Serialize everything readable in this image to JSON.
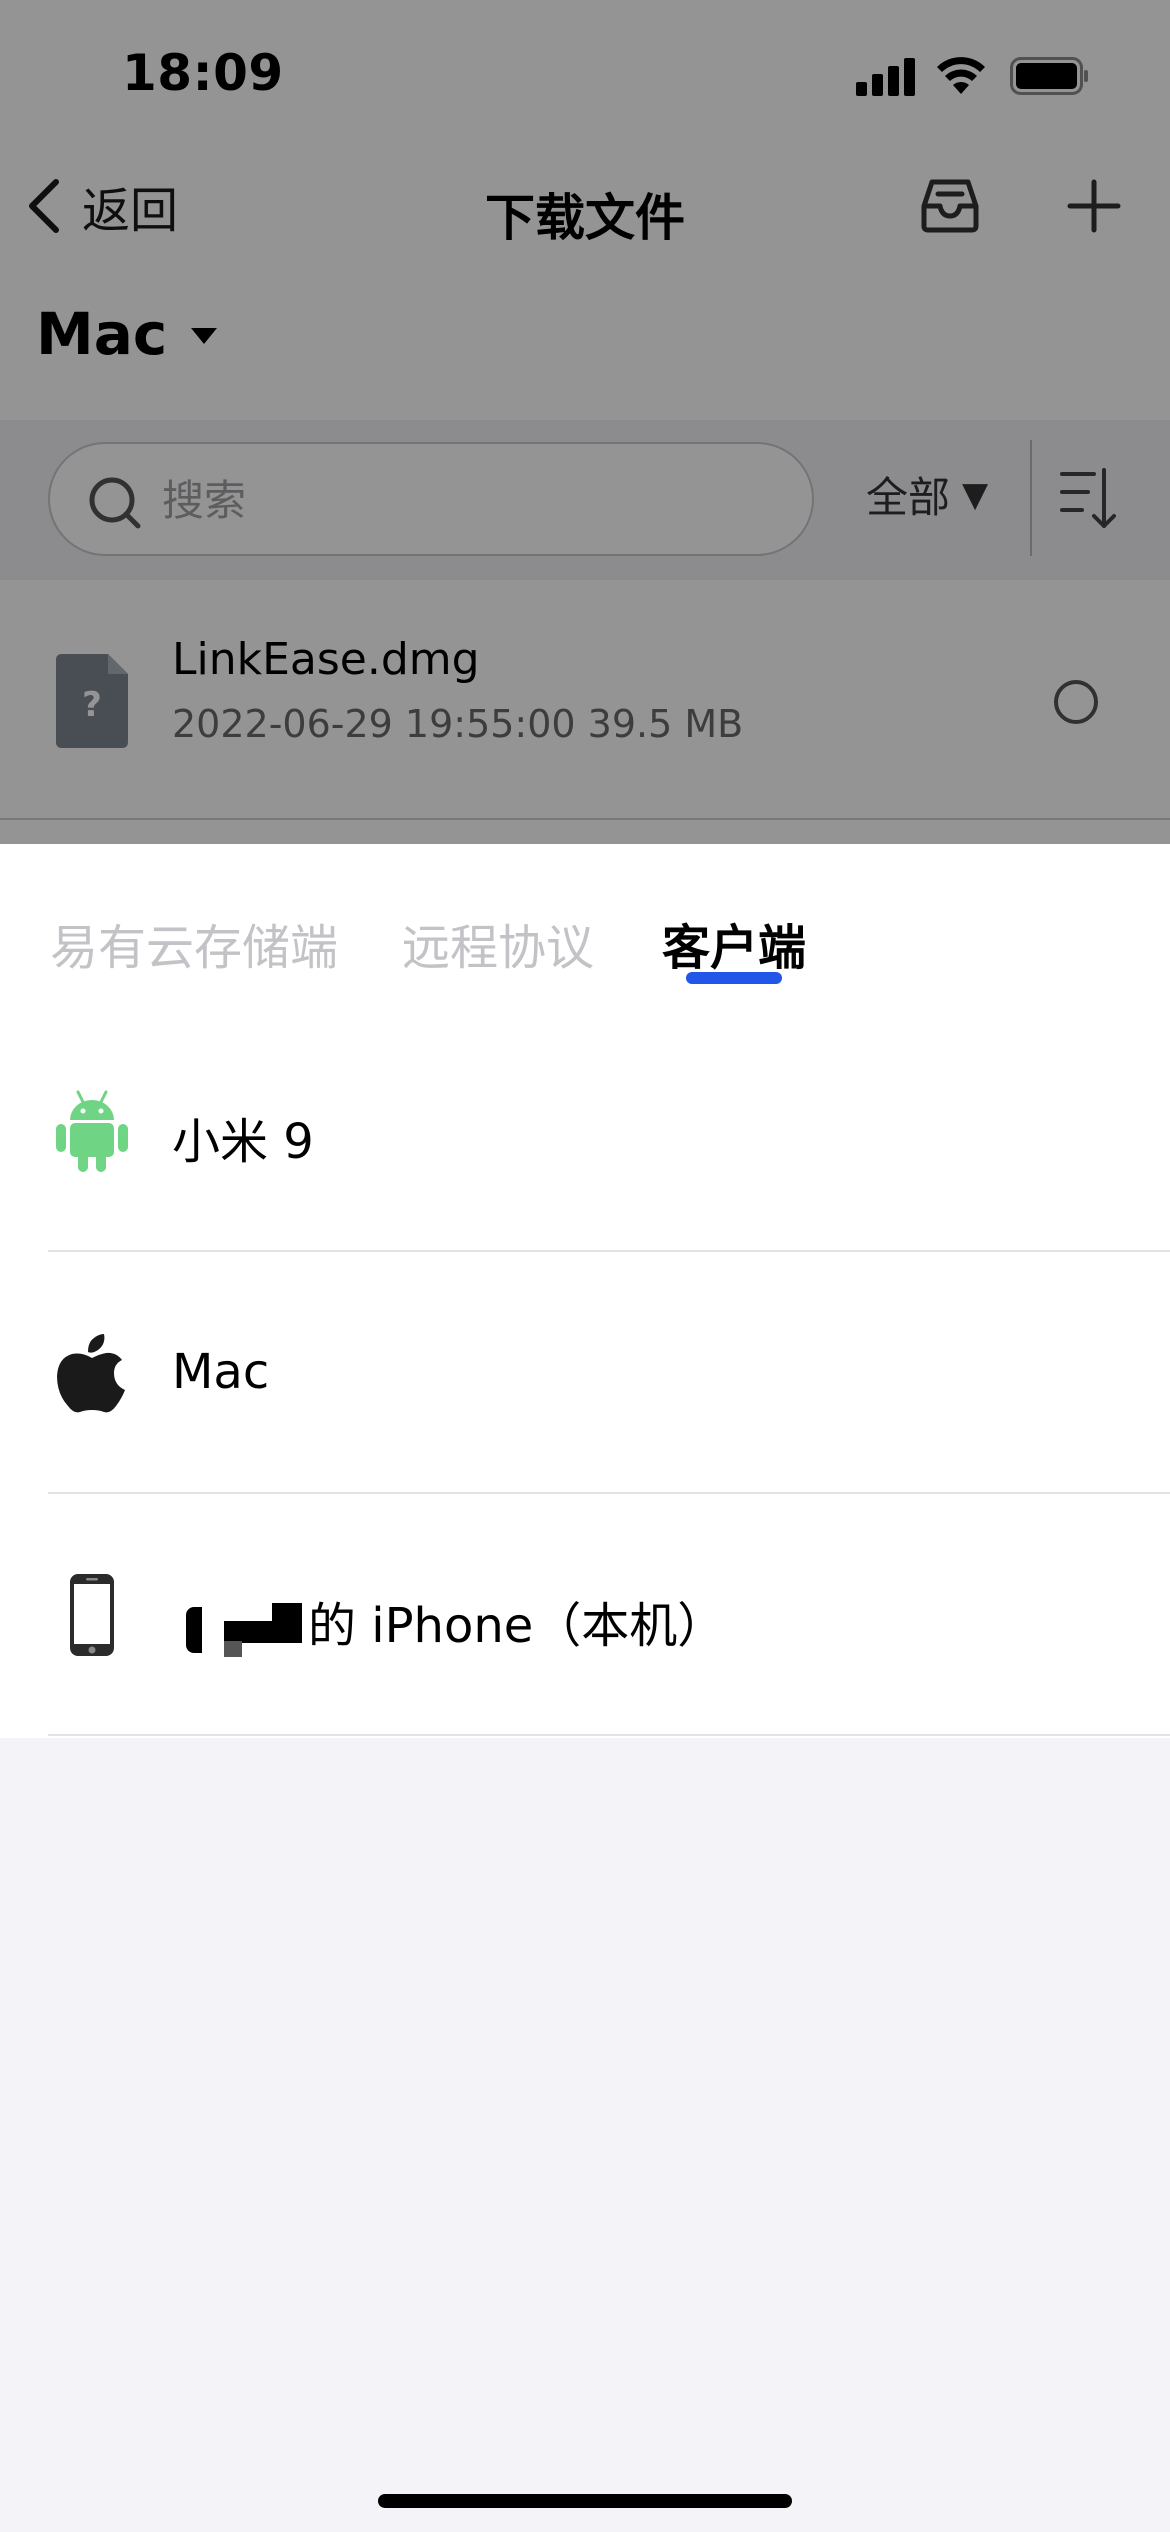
{
  "status_bar": {
    "time": "18:09",
    "signal_icon": "cellular-signal-icon",
    "wifi_icon": "wifi-icon",
    "battery_icon": "battery-full-icon"
  },
  "nav": {
    "back_label": "返回",
    "back_icon": "chevron-left-icon",
    "title": "下载文件",
    "inbox_icon": "inbox-tray-icon",
    "add_icon": "plus-icon"
  },
  "device_switcher": {
    "label": "Mac",
    "caret_icon": "caret-down-icon"
  },
  "toolbar": {
    "search_placeholder": "搜索",
    "search_value": "",
    "filter_label": "全部",
    "filter_caret": "▼",
    "sort_icon": "sort-descending-icon"
  },
  "files": [
    {
      "name": "LinkEase.dmg",
      "meta": "2022-06-29 19:55:00 39.5 MB",
      "icon": "unknown-file-icon",
      "selected": false
    }
  ],
  "sheet": {
    "tabs": [
      {
        "label": "易有云存储端",
        "active": false
      },
      {
        "label": "远程协议",
        "active": false
      },
      {
        "label": "客户端",
        "active": true
      }
    ],
    "accent_color": "#2256e8",
    "devices": [
      {
        "label": "小米 9",
        "icon": "android-icon"
      },
      {
        "label": "Mac",
        "icon": "apple-icon"
      },
      {
        "label": "的 iPhone（本机）",
        "icon": "iphone-icon"
      }
    ]
  }
}
